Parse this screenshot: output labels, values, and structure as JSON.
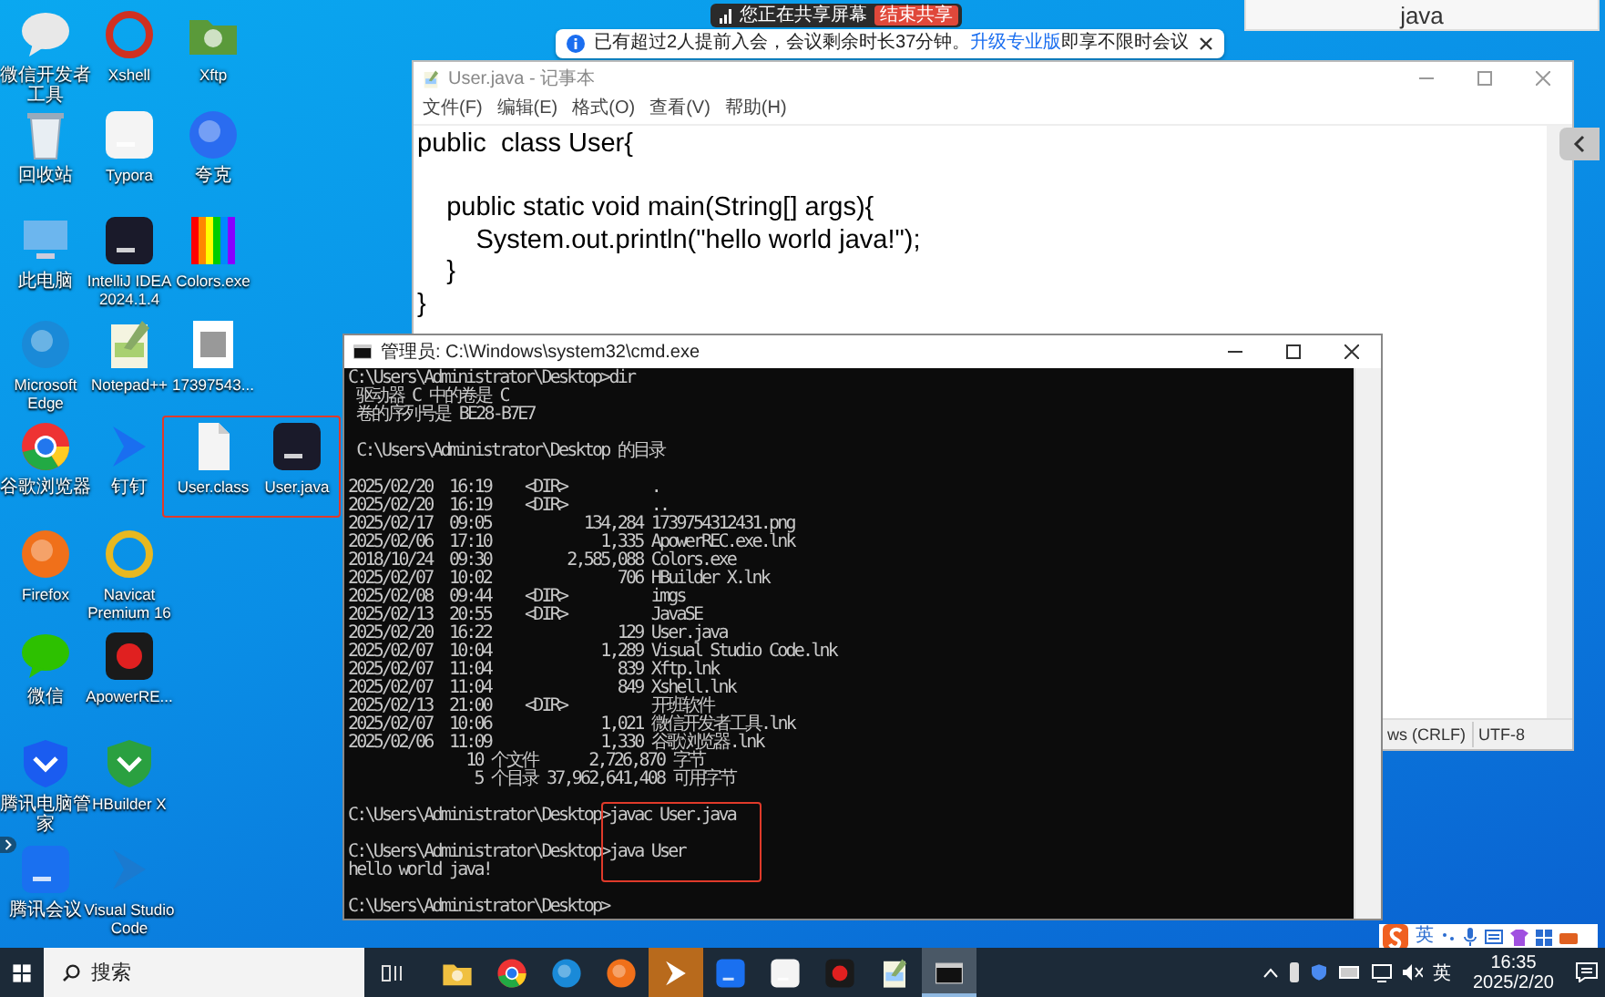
{
  "screen_share": {
    "status": "您正在共享屏幕",
    "stop_button": "结束共享"
  },
  "meeting_notice": {
    "text": "已有超过2人提前入会，会议剩余时长37分钟。",
    "link": "升级专业版",
    "suffix": "即享不限时会议"
  },
  "top_panel": {
    "text": "java"
  },
  "desktop_icons": [
    {
      "label": "微信开发者工具",
      "highlighted": false
    },
    {
      "label": "Xshell",
      "highlighted": false
    },
    {
      "label": "Xftp",
      "highlighted": false
    },
    {
      "label": "回收站",
      "highlighted": false
    },
    {
      "label": "Typora",
      "highlighted": false
    },
    {
      "label": "夸克",
      "highlighted": false
    },
    {
      "label": "此电脑",
      "highlighted": false
    },
    {
      "label": "IntelliJ IDEA 2024.1.4",
      "highlighted": false
    },
    {
      "label": "Colors.exe",
      "highlighted": false
    },
    {
      "label": "Microsoft Edge",
      "highlighted": false
    },
    {
      "label": "Notepad++",
      "highlighted": false
    },
    {
      "label": "17397543...",
      "highlighted": false
    },
    {
      "label": "谷歌浏览器",
      "highlighted": false
    },
    {
      "label": "钉钉",
      "highlighted": false
    },
    {
      "label": "User.class",
      "highlighted": true
    },
    {
      "label": "User.java",
      "highlighted": true
    },
    {
      "label": "Firefox",
      "highlighted": false
    },
    {
      "label": "Navicat Premium 16",
      "highlighted": false
    },
    {
      "label": "微信",
      "highlighted": false
    },
    {
      "label": "ApowerRE...",
      "highlighted": false
    },
    {
      "label": "腾讯电脑管家",
      "highlighted": false
    },
    {
      "label": "HBuilder X",
      "highlighted": false
    },
    {
      "label": "腾讯会议",
      "highlighted": false
    },
    {
      "label": "Visual Studio Code",
      "highlighted": false
    }
  ],
  "notepad": {
    "title": "User.java - 记事本",
    "menu": [
      "文件(F)",
      "编辑(E)",
      "格式(O)",
      "查看(V)",
      "帮助(H)"
    ],
    "code_blocks": [
      [
        "public  class User{"
      ],
      [
        "    public static void main(String[] args){",
        "        System.out.println(\"hello world java!\");",
        "    }",
        "}"
      ]
    ],
    "status": [
      "ws (CRLF)",
      "UTF-8"
    ]
  },
  "cmd": {
    "title": "管理员: C:\\Windows\\system32\\cmd.exe",
    "lines": [
      {
        "text": "C:\\Users\\Administrator\\Desktop>dir",
        "highlighted": false
      },
      {
        "text": " 驱动器 C 中的卷是 C",
        "highlighted": false
      },
      {
        "text": " 卷的序列号是 BE28-B7E7",
        "highlighted": false
      },
      {
        "highlighted": false
      },
      {
        "text": " C:\\Users\\Administrator\\Desktop 的目录",
        "highlighted": false
      },
      {
        "highlighted": false
      },
      {
        "text": "2025/02/20  16:19    <DIR>          .",
        "highlighted": false
      },
      {
        "text": "2025/02/20  16:19    <DIR>          ..",
        "highlighted": false
      },
      {
        "text": "2025/02/17  09:05           134,284 1739754312431.png",
        "highlighted": false
      },
      {
        "text": "2025/02/06  17:10             1,335 ApowerREC.exe.lnk",
        "highlighted": false
      },
      {
        "text": "2018/10/24  09:30         2,585,088 Colors.exe",
        "highlighted": false
      },
      {
        "text": "2025/02/07  10:02               706 HBuilder X.lnk",
        "highlighted": false
      },
      {
        "text": "2025/02/08  09:44    <DIR>          imgs",
        "highlighted": false
      },
      {
        "text": "2025/02/13  20:55    <DIR>          JavaSE",
        "highlighted": false
      },
      {
        "text": "2025/02/20  16:22               129 User.java",
        "highlighted": false
      },
      {
        "text": "2025/02/07  10:04             1,289 Visual Studio Code.lnk",
        "highlighted": false
      },
      {
        "text": "2025/02/07  11:04               839 Xftp.lnk",
        "highlighted": false
      },
      {
        "text": "2025/02/07  11:04               849 Xshell.lnk",
        "highlighted": false
      },
      {
        "text": "2025/02/13  21:00    <DIR>          开班软件",
        "highlighted": false
      },
      {
        "text": "2025/02/07  10:06             1,021 微信开发者工具.lnk",
        "highlighted": false
      },
      {
        "text": "2025/02/06  11:09             1,330 谷歌浏览器.lnk",
        "highlighted": false
      },
      {
        "text": "              10 个文件      2,726,870 字节",
        "highlighted": false
      },
      {
        "text": "               5 个目录 37,962,641,408 可用字节",
        "highlighted": false
      },
      {
        "highlighted": false
      },
      {
        "text": "C:\\Users\\Administrator\\Desktop>javac User.java",
        "highlighted": true
      },
      {
        "highlighted": true
      },
      {
        "text": "C:\\Users\\Administrator\\Desktop>java User",
        "highlighted": true
      },
      {
        "text": "hello world java!",
        "highlighted": false
      },
      {
        "highlighted": false
      },
      {
        "text": "C:\\Users\\Administrator\\Desktop>",
        "highlighted": false
      }
    ]
  },
  "ime_toolbar": {
    "mode": "英"
  },
  "taskbar": {
    "search_placeholder": "搜索",
    "apps": [
      {
        "selected": false,
        "attention": false
      },
      {
        "selected": false,
        "attention": false
      },
      {
        "selected": false,
        "attention": false
      },
      {
        "selected": false,
        "attention": false
      },
      {
        "selected": false,
        "attention": true
      },
      {
        "selected": false,
        "attention": false
      },
      {
        "selected": false,
        "attention": false
      },
      {
        "selected": false,
        "attention": false
      },
      {
        "selected": false,
        "attention": false
      },
      {
        "selected": true,
        "attention": false
      }
    ],
    "input_mode": "英",
    "time": "16:35",
    "date": "2025/2/20"
  }
}
